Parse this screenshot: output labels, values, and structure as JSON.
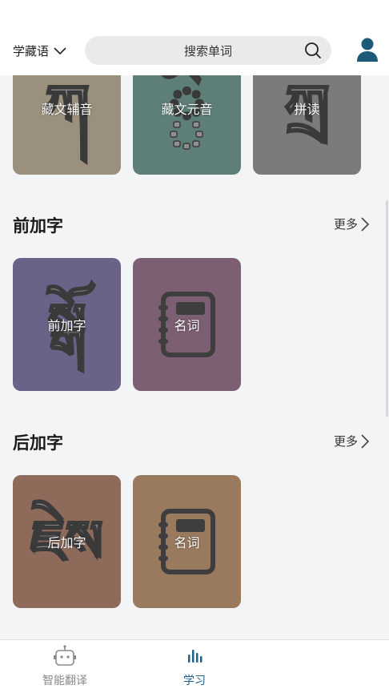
{
  "header": {
    "language_label": "学藏语",
    "search_placeholder": "搜索单词"
  },
  "top_cards": [
    {
      "label": "藏文辅音",
      "glyph": "ཀ",
      "bg": "#9a907d"
    },
    {
      "label": "藏文元音",
      "glyph": "ི",
      "bg": "#5e7f78"
    },
    {
      "label": "拼读",
      "glyph": "ཀྲ",
      "bg": "#7a7b7a"
    }
  ],
  "sections": [
    {
      "title": "前加字",
      "more": "更多",
      "cards": [
        {
          "label": "前加字",
          "glyph": "སྒོ",
          "bg": "#6a6287",
          "icon": "tibetan-glyph"
        },
        {
          "label": "名词",
          "bg": "#7c5f72",
          "icon": "notebook-icon"
        }
      ]
    },
    {
      "title": "后加字",
      "more": "更多",
      "cards": [
        {
          "label": "后加字",
          "glyph": "ཇེས",
          "bg": "#8d6a5a",
          "icon": "tibetan-glyph"
        },
        {
          "label": "名词",
          "bg": "#9a7a5f",
          "icon": "notebook-icon"
        }
      ]
    }
  ],
  "tabbar": {
    "tabs": [
      {
        "label": "智能翻译",
        "active": false,
        "icon": "robot-icon"
      },
      {
        "label": "学习",
        "active": true,
        "icon": "bars-icon"
      }
    ],
    "active_color": "#1f5f8b",
    "inactive_color": "#8a8a8a"
  }
}
